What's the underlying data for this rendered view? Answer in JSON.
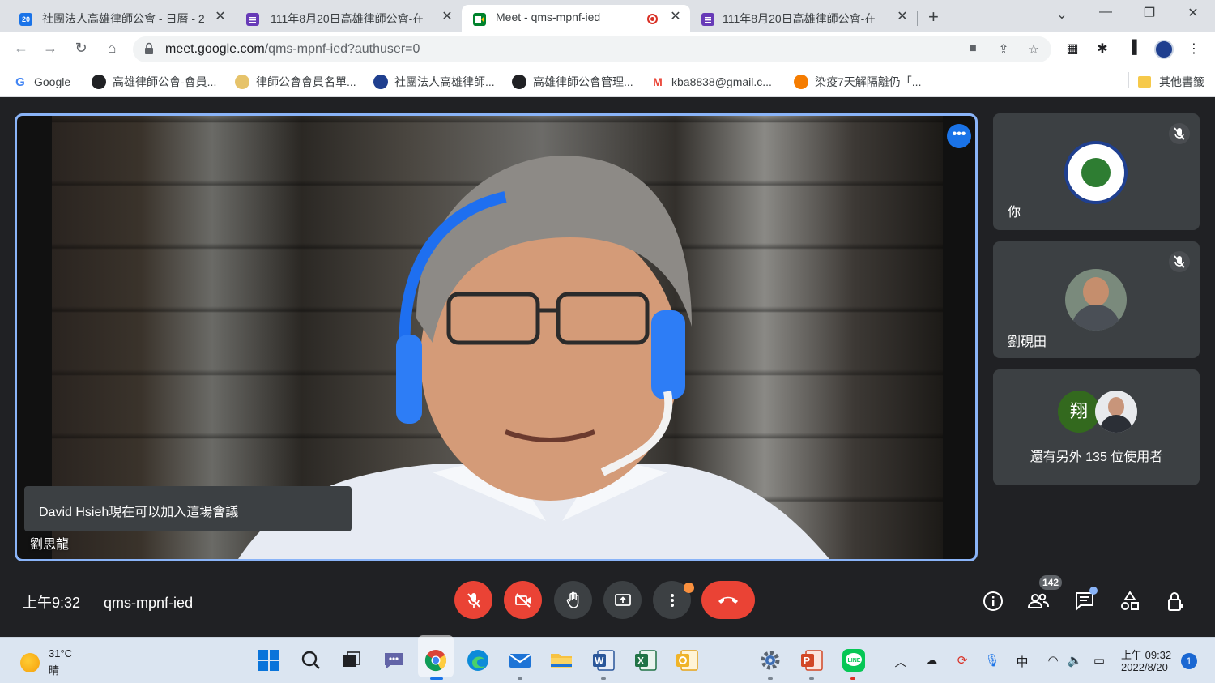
{
  "browser": {
    "tabs": [
      {
        "title": "社團法人高雄律師公會 - 日曆 - 2",
        "favicon": "calendar-icon",
        "favicon_text": "20",
        "color": "#1a73e8"
      },
      {
        "title": "111年8月20日高雄律師公會-在",
        "favicon": "forms-icon",
        "color": "#673ab7"
      },
      {
        "title": "Meet - qms-mpnf-ied",
        "favicon": "meet-icon",
        "color": "#00832d",
        "active": true
      },
      {
        "title": "111年8月20日高雄律師公會-在",
        "favicon": "forms-icon",
        "color": "#673ab7"
      }
    ],
    "close_glyph": "✕",
    "new_tab_glyph": "+",
    "url_host": "meet.google.com",
    "url_path": "/qms-mpnf-ied?authuser=0",
    "bookmarks": [
      {
        "label": "Google",
        "icon": "google-icon",
        "color": "#4285f4",
        "glyph": "G"
      },
      {
        "label": "高雄律師公會-會員...",
        "icon": "site-icon",
        "color": "#202124",
        "glyph": "●"
      },
      {
        "label": "律師公會會員名單...",
        "icon": "site-icon",
        "color": "#e6c36a",
        "glyph": "●"
      },
      {
        "label": "社團法人高雄律師...",
        "icon": "bar-association-icon",
        "color": "#1f3f8f",
        "glyph": "●"
      },
      {
        "label": "高雄律師公會管理...",
        "icon": "site-icon",
        "color": "#202124",
        "glyph": "●"
      },
      {
        "label": "kba8838@gmail.c...",
        "icon": "gmail-icon",
        "color": "#ea4335",
        "glyph": "M"
      },
      {
        "label": "染疫7天解隔離仍「...",
        "icon": "news-icon",
        "color": "#f57c00",
        "glyph": "●"
      }
    ],
    "other_bookmarks": "其他書籤"
  },
  "meet": {
    "main_speaker": "劉思龍",
    "toast": "David Hsieh現在可以加入這場會議",
    "participants": [
      {
        "name": "你"
      },
      {
        "name": "劉硯田"
      }
    ],
    "more_avatar_initial": "翔",
    "more_users": "還有另外 135 位使用者",
    "time": "上午9:32",
    "meeting_code": "qms-mpnf-ied",
    "people_count": "142",
    "colors": {
      "accent": "#8ab4f8",
      "danger": "#ea4335",
      "tile": "#3c4043"
    }
  },
  "taskbar": {
    "temperature": "31°C",
    "weather": "晴",
    "ime": "中",
    "clock_time": "上午 09:32",
    "clock_date": "2022/8/20",
    "notifications": "1"
  }
}
